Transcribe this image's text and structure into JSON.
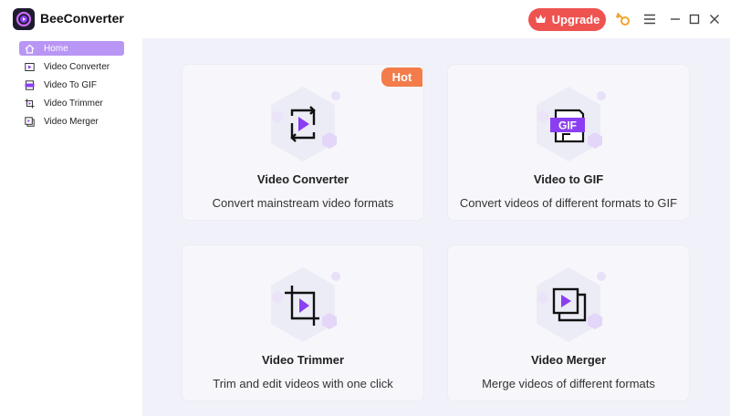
{
  "app": {
    "title": "BeeConverter"
  },
  "header": {
    "upgrade_label": "Upgrade"
  },
  "sidebar": {
    "items": [
      {
        "label": "Home",
        "icon": "home-icon",
        "active": true
      },
      {
        "label": "Video Converter",
        "icon": "video-converter-icon",
        "active": false
      },
      {
        "label": "Video To GIF",
        "icon": "gif-icon",
        "active": false
      },
      {
        "label": "Video Trimmer",
        "icon": "crop-icon",
        "active": false
      },
      {
        "label": "Video Merger",
        "icon": "merge-icon",
        "active": false
      }
    ]
  },
  "cards": [
    {
      "title": "Video Converter",
      "desc": "Convert mainstream video formats",
      "badge": "Hot",
      "icon": "convert-icon"
    },
    {
      "title": "Video to GIF",
      "desc": "Convert videos of different formats to GIF",
      "icon": "gif-icon",
      "icon_text": "GIF"
    },
    {
      "title": "Video Trimmer",
      "desc": "Trim and edit videos with one click",
      "icon": "crop-icon"
    },
    {
      "title": "Video Merger",
      "desc": "Merge videos of different formats",
      "icon": "merge-icon"
    }
  ],
  "colors": {
    "accent": "#8a3ff2",
    "upgrade": "#ef5350",
    "hot": "#f37c4a",
    "active_nav": "#b996f5"
  }
}
